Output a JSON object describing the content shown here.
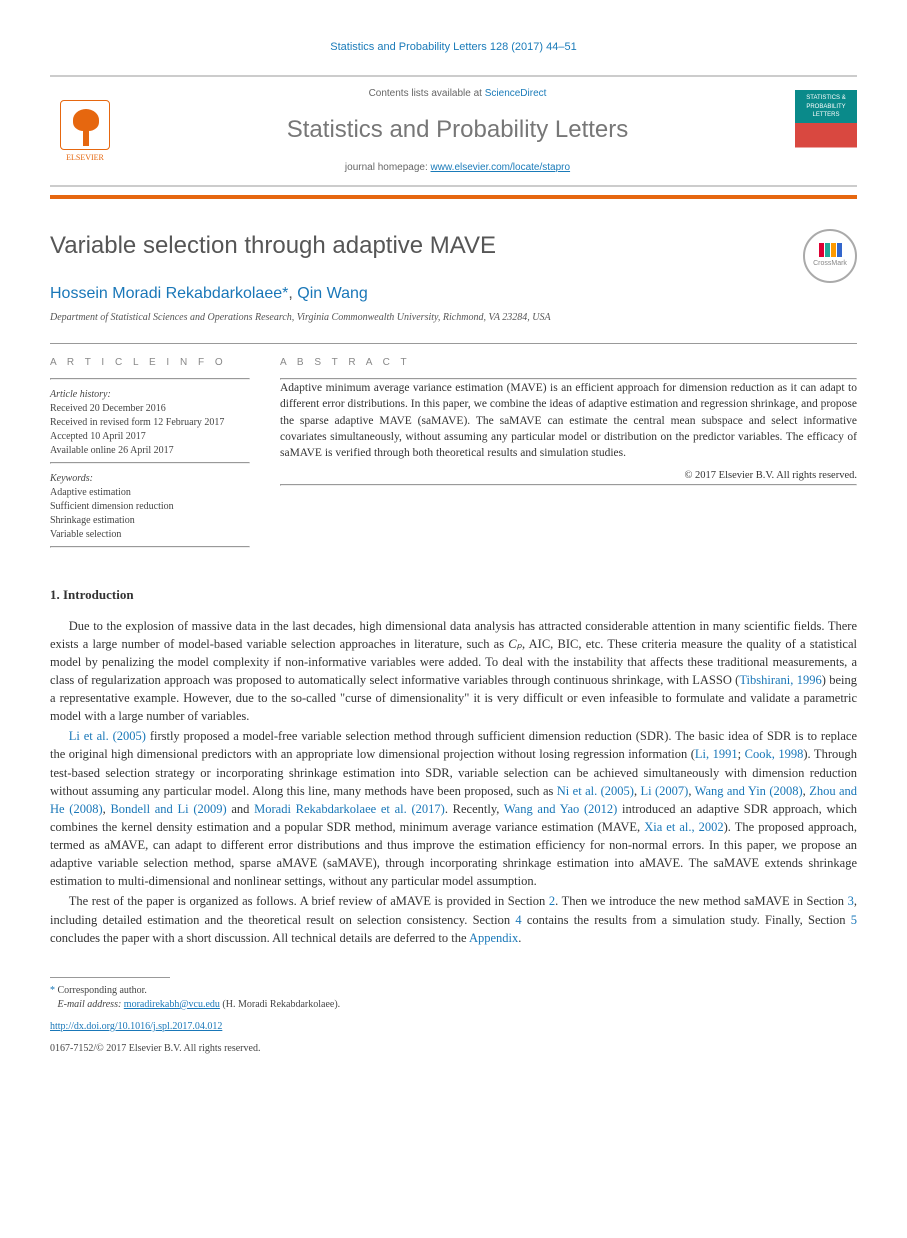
{
  "citation": "Statistics and Probability Letters 128 (2017) 44–51",
  "header": {
    "publisher": "ELSEVIER",
    "contents_prefix": "Contents lists available at ",
    "contents_link": "ScienceDirect",
    "journal_title": "Statistics and Probability Letters",
    "homepage_prefix": "journal homepage: ",
    "homepage_link": "www.elsevier.com/locate/stapro",
    "cover_text": "STATISTICS & PROBABILITY LETTERS"
  },
  "article": {
    "title": "Variable selection through adaptive MAVE",
    "crossmark": "CrossMark",
    "author1_name": "Hossein Moradi Rekabdarkolaee",
    "author_sep": ", ",
    "author2_name": "Qin Wang",
    "corr_symbol": "*",
    "affiliation": "Department of Statistical Sciences and Operations Research, Virginia Commonwealth University, Richmond, VA 23284, USA"
  },
  "info": {
    "heading": "A R T I C L E   I N F O",
    "history_label": "Article history:",
    "received": "Received 20 December 2016",
    "revised": "Received in revised form 12 February 2017",
    "accepted": "Accepted 10 April 2017",
    "online": "Available online 26 April 2017",
    "keywords_label": "Keywords:",
    "kw1": "Adaptive estimation",
    "kw2": "Sufficient dimension reduction",
    "kw3": "Shrinkage estimation",
    "kw4": "Variable selection"
  },
  "abstract": {
    "heading": "A B S T R A C T",
    "text": "Adaptive minimum average variance estimation (MAVE) is an efficient approach for dimension reduction as it can adapt to different error distributions. In this paper, we combine the ideas of adaptive estimation and regression shrinkage, and propose the sparse adaptive MAVE (saMAVE). The saMAVE can estimate the central mean subspace and select informative covariates simultaneously, without assuming any particular model or distribution on the predictor variables. The efficacy of saMAVE is verified through both theoretical results and simulation studies.",
    "copyright": "© 2017 Elsevier B.V. All rights reserved."
  },
  "sections": {
    "s1_heading": "1.  Introduction",
    "p1_a": "Due to the explosion of massive data in the last decades, high dimensional data analysis has attracted considerable attention in many scientific fields. There exists a large number of model-based variable selection approaches in literature, such as ",
    "p1_cp": "Cₚ",
    "p1_b": ", AIC, BIC, etc. These criteria measure the quality of a statistical model by penalizing the model complexity if non-informative variables were added. To deal with the instability that affects these traditional measurements, a class of regularization approach was proposed to automatically select informative variables through continuous shrinkage, with LASSO (",
    "p1_ref1": "Tibshirani, 1996",
    "p1_c": ") being a representative example. However, due to the so-called \"curse of dimensionality\" it is very difficult or even infeasible to formulate and validate a parametric model with a large number of variables.",
    "p2_ref1": "Li et al. (2005)",
    "p2_a": " firstly proposed a model-free variable selection method through sufficient dimension reduction (SDR). The basic idea of SDR is to replace the original high dimensional predictors with an appropriate low dimensional projection without losing regression information (",
    "p2_ref2": "Li, 1991",
    "p2_sep1": "; ",
    "p2_ref3": "Cook, 1998",
    "p2_b": "). Through test-based selection strategy or incorporating shrinkage estimation into SDR, variable selection can be achieved simultaneously with dimension reduction without assuming any particular model. Along this line, many methods have been proposed, such as ",
    "p2_ref4": "Ni et al. (2005)",
    "p2_sep2": ", ",
    "p2_ref5": "Li (2007)",
    "p2_sep3": ", ",
    "p2_ref6": "Wang and Yin (2008)",
    "p2_sep4": ", ",
    "p2_ref7": "Zhou and He (2008)",
    "p2_sep5": ", ",
    "p2_ref8": "Bondell and Li (2009)",
    "p2_and": " and ",
    "p2_ref9": "Moradi Rekabdarkolaee et al. (2017)",
    "p2_c": ". Recently, ",
    "p2_ref10": "Wang and Yao (2012)",
    "p2_d": " introduced an adaptive SDR approach, which combines the kernel density estimation and a popular SDR method, minimum average variance estimation (MAVE, ",
    "p2_ref11": "Xia et al., 2002",
    "p2_e": "). The proposed approach, termed as aMAVE, can adapt to different error distributions and thus improve the estimation efficiency for non-normal errors. In this paper, we propose an adaptive variable selection method, sparse aMAVE (saMAVE), through incorporating shrinkage estimation into aMAVE. The saMAVE extends shrinkage estimation to multi-dimensional and nonlinear settings, without any particular model assumption.",
    "p3_a": "The rest of the paper is organized as follows. A brief review of aMAVE is provided in Section ",
    "p3_s2": "2",
    "p3_b": ". Then we introduce the new method saMAVE in Section ",
    "p3_s3": "3",
    "p3_c": ", including detailed estimation and the theoretical result on selection consistency. Section ",
    "p3_s4": "4",
    "p3_d": " contains the results from a simulation study. Finally, Section ",
    "p3_s5": "5",
    "p3_e": " concludes the paper with a short discussion. All technical details are deferred to the ",
    "p3_appendix": "Appendix",
    "p3_f": "."
  },
  "footnote": {
    "corr_label": "Corresponding author.",
    "email_label": "E-mail address:",
    "email": "moradirekabh@vcu.edu",
    "email_who": "(H. Moradi Rekabdarkolaee)."
  },
  "footer": {
    "doi": "http://dx.doi.org/10.1016/j.spl.2017.04.012",
    "issn_line": "0167-7152/© 2017 Elsevier B.V. All rights reserved."
  }
}
